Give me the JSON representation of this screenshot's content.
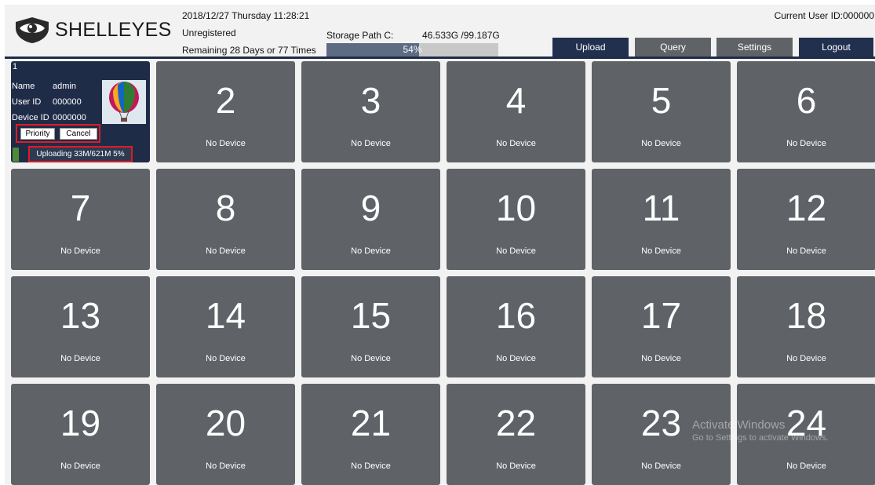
{
  "header": {
    "brand": "SHELLEYES",
    "datetime": "2018/12/27 Thursday 11:28:21",
    "registration": "Unregistered",
    "remaining": "Remaining 28 Days or 77 Times",
    "storage_label": "Storage Path C:",
    "storage_capacity": "46.533G /99.187G",
    "storage_percent_text": "54%",
    "storage_fraction": 0.54,
    "current_user": "Current User ID:000000"
  },
  "toolbar": {
    "upload": "Upload",
    "query": "Query",
    "settings": "Settings",
    "logout": "Logout"
  },
  "active_device": {
    "index": "1",
    "name_label": "Name",
    "name_value": "admin",
    "userid_label": "User ID",
    "userid_value": "000000",
    "deviceid_label": "Device ID",
    "deviceid_value": "0000000",
    "priority": "Priority",
    "cancel": "Cancel",
    "upload_status": "Uploading 33M/621M 5%"
  },
  "tiles": [
    {
      "num": "2",
      "status": "No Device"
    },
    {
      "num": "3",
      "status": "No Device"
    },
    {
      "num": "4",
      "status": "No Device"
    },
    {
      "num": "5",
      "status": "No Device"
    },
    {
      "num": "6",
      "status": "No Device"
    },
    {
      "num": "7",
      "status": "No Device"
    },
    {
      "num": "8",
      "status": "No Device"
    },
    {
      "num": "9",
      "status": "No Device"
    },
    {
      "num": "10",
      "status": "No Device"
    },
    {
      "num": "11",
      "status": "No Device"
    },
    {
      "num": "12",
      "status": "No Device"
    },
    {
      "num": "13",
      "status": "No Device"
    },
    {
      "num": "14",
      "status": "No Device"
    },
    {
      "num": "15",
      "status": "No Device"
    },
    {
      "num": "16",
      "status": "No Device"
    },
    {
      "num": "17",
      "status": "No Device"
    },
    {
      "num": "18",
      "status": "No Device"
    },
    {
      "num": "19",
      "status": "No Device"
    },
    {
      "num": "20",
      "status": "No Device"
    },
    {
      "num": "21",
      "status": "No Device"
    },
    {
      "num": "22",
      "status": "No Device"
    },
    {
      "num": "23",
      "status": "No Device"
    },
    {
      "num": "24",
      "status": "No Device"
    }
  ],
  "watermark": {
    "line1": "Activate Windows",
    "line2": "Go to Settings to activate Windows."
  },
  "colors": {
    "navy": "#21304f",
    "tile_gray": "#5f6368",
    "highlight_red": "#e01b24"
  }
}
